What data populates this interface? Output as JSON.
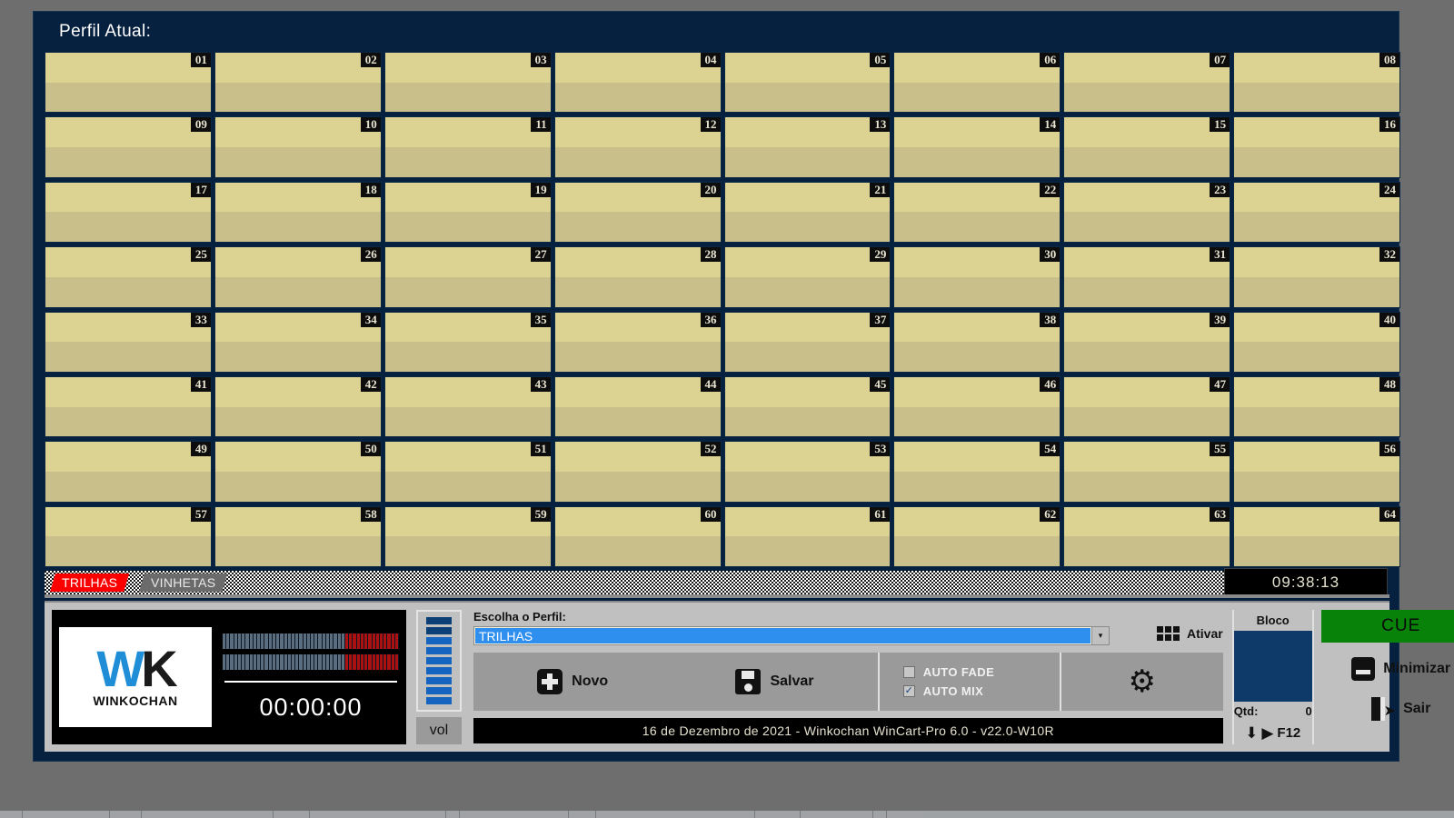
{
  "window": {
    "profile_header": "Perfil Atual:"
  },
  "cart_grid": {
    "rows": 8,
    "cols": 8,
    "cells": [
      "01",
      "02",
      "03",
      "04",
      "05",
      "06",
      "07",
      "08",
      "09",
      "10",
      "11",
      "12",
      "13",
      "14",
      "15",
      "16",
      "17",
      "18",
      "19",
      "20",
      "21",
      "22",
      "23",
      "24",
      "25",
      "26",
      "27",
      "28",
      "29",
      "30",
      "31",
      "32",
      "33",
      "34",
      "35",
      "36",
      "37",
      "38",
      "39",
      "40",
      "41",
      "42",
      "43",
      "44",
      "45",
      "46",
      "47",
      "48",
      "49",
      "50",
      "51",
      "52",
      "53",
      "54",
      "55",
      "56",
      "57",
      "58",
      "59",
      "60",
      "61",
      "62",
      "63",
      "64"
    ]
  },
  "tabs": [
    {
      "label": "TRILHAS",
      "active": true
    },
    {
      "label": "VINHETAS",
      "active": false
    }
  ],
  "clock": {
    "time": "09:38:13"
  },
  "player": {
    "logo_w": "W",
    "logo_k": "K",
    "logo_name": "WINKOCHAN",
    "time_display": "00:00:00",
    "vol_label": "vol"
  },
  "profile": {
    "label": "Escolha o Perfil:",
    "selected": "TRILHAS",
    "arrow": "▾"
  },
  "ativar": {
    "label": "Ativar",
    "icon": "grid-icon"
  },
  "actions": [
    {
      "label": "Novo",
      "icon": "plus-icon"
    },
    {
      "label": "Salvar",
      "icon": "save-icon"
    }
  ],
  "checkboxes": [
    {
      "label": "AUTO FADE",
      "checked": false,
      "mark": ""
    },
    {
      "label": "AUTO MIX",
      "checked": true,
      "mark": "✓"
    }
  ],
  "settings": {
    "icon": "gear-icon",
    "glyph": "⚙"
  },
  "status_bar": {
    "text": "16 de Dezembro de 2021   -   Winkochan WinCart-Pro 6.0 - v22.0-W10R"
  },
  "bloco": {
    "title": "Bloco",
    "qtd_label": "Qtd:",
    "qtd_value": "0",
    "key_label": "F12",
    "arrow_down": "⬇",
    "arrow_play": "▶"
  },
  "right_buttons": {
    "cue": "CUE",
    "minimizar": "Minimizar",
    "sair": "Sair"
  },
  "colors": {
    "desktop": "#6e6e6e",
    "window_bg": "#06203f",
    "cart_top": "#dcd292",
    "cart_bottom": "#c8bf8a",
    "tab_active": "#fc0000",
    "tab_inactive": "#6b6b6b",
    "panel": "#c0c0c0",
    "cue_green": "#088208",
    "combo_blue": "#2f8fef",
    "bloco_blue": "#0d3a68"
  }
}
